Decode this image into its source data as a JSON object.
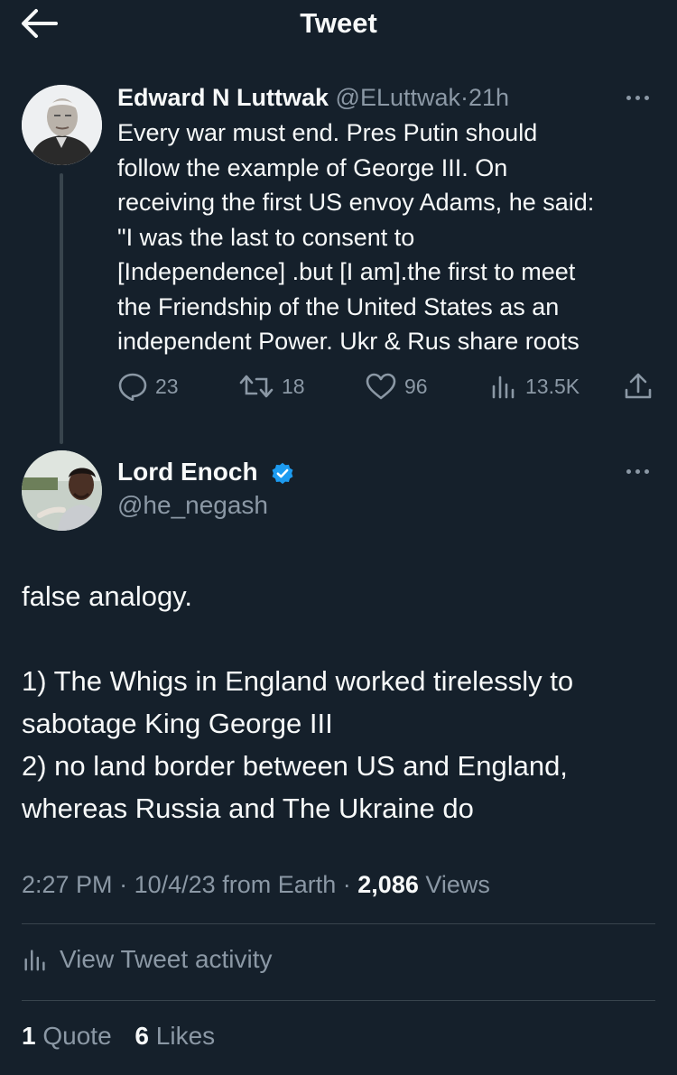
{
  "header": {
    "title": "Tweet"
  },
  "parent_tweet": {
    "author_name": "Edward N Luttwak",
    "handle": "@ELuttwak",
    "separator": "·",
    "time_ago": "21h",
    "text_lines": [
      "Every war must end.  Pres Putin should",
      "follow the example of George III.  On",
      "receiving the first US envoy Adams, he said:",
      "\"I was the last to consent to",
      "[Independence] .but [I am].the first to meet",
      "the Friendship of the United States as an",
      "independent Power. Ukr & Rus share roots"
    ],
    "replies": "23",
    "retweets": "18",
    "likes": "96",
    "views": "13.5K"
  },
  "reply_tweet": {
    "author_name": "Lord Enoch",
    "handle": "@he_negash",
    "verified_color": "#1d9bf0",
    "text_lines": [
      "false analogy.",
      "",
      "1) The Whigs in England worked tirelessly to",
      "sabotage King George III",
      "2) no land border between US and England,",
      "whereas Russia and The Ukraine do"
    ],
    "time": "2:27 PM",
    "separator": "·",
    "date": "10/4/23",
    "source": "from Earth",
    "views_count": "2,086",
    "views_label": "Views",
    "activity_label": "View Tweet activity",
    "quotes_count": "1",
    "quotes_label": "Quote",
    "likes_count": "6",
    "likes_label": "Likes"
  },
  "colors": {
    "background": "#15202b",
    "text": "#f7f9f9",
    "muted": "#8b98a5",
    "divider": "#38444d",
    "accent": "#1d9bf0"
  },
  "icons": [
    "back-arrow-icon",
    "more-icon",
    "reply-icon",
    "retweet-icon",
    "like-icon",
    "views-icon",
    "share-icon",
    "verified-badge-icon",
    "activity-icon"
  ]
}
